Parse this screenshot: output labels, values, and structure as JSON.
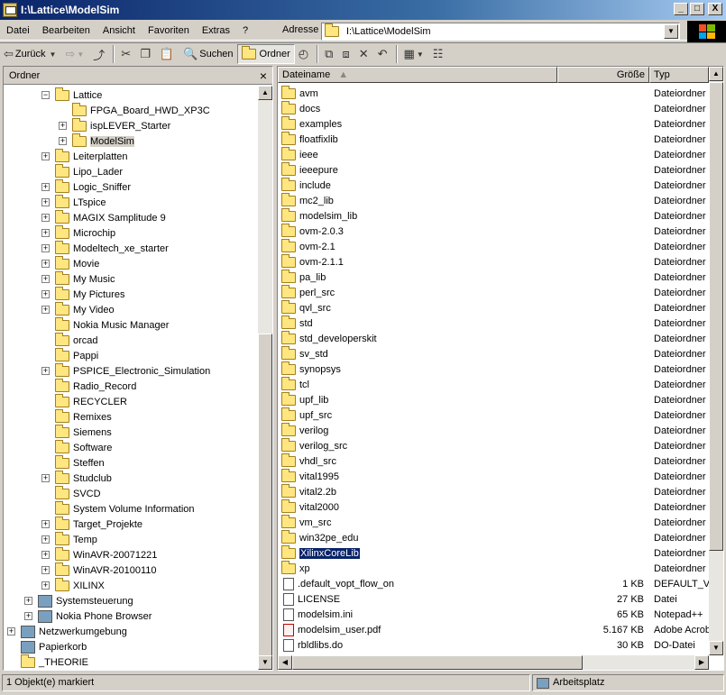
{
  "window": {
    "title": "I:\\Lattice\\ModelSim",
    "buttons": {
      "minimize": "_",
      "maximize": "□",
      "close": "X"
    }
  },
  "menu": [
    "Datei",
    "Bearbeiten",
    "Ansicht",
    "Favoriten",
    "Extras",
    "?"
  ],
  "address": {
    "label": "Adresse",
    "value": "I:\\Lattice\\ModelSim"
  },
  "toolbar": {
    "back": "Zurück",
    "search": "Suchen",
    "folders": "Ordner"
  },
  "left_pane": {
    "title": "Ordner",
    "close": "×",
    "tree": [
      {
        "label": "Lattice",
        "exp": "−",
        "indent": 2,
        "icon": "folder"
      },
      {
        "label": "FPGA_Board_HWD_XP3C",
        "exp": "",
        "indent": 3,
        "icon": "folder"
      },
      {
        "label": "ispLEVER_Starter",
        "exp": "+",
        "indent": 3,
        "icon": "folder"
      },
      {
        "label": "ModelSim",
        "exp": "+",
        "indent": 3,
        "icon": "folder-open",
        "selected": true
      },
      {
        "label": "Leiterplatten",
        "exp": "+",
        "indent": 2,
        "icon": "folder"
      },
      {
        "label": "Lipo_Lader",
        "exp": "",
        "indent": 2,
        "icon": "folder"
      },
      {
        "label": "Logic_Sniffer",
        "exp": "+",
        "indent": 2,
        "icon": "folder"
      },
      {
        "label": "LTspice",
        "exp": "+",
        "indent": 2,
        "icon": "folder"
      },
      {
        "label": "MAGIX Samplitude 9",
        "exp": "+",
        "indent": 2,
        "icon": "folder"
      },
      {
        "label": "Microchip",
        "exp": "+",
        "indent": 2,
        "icon": "folder"
      },
      {
        "label": "Modeltech_xe_starter",
        "exp": "+",
        "indent": 2,
        "icon": "folder"
      },
      {
        "label": "Movie",
        "exp": "+",
        "indent": 2,
        "icon": "folder"
      },
      {
        "label": "My Music",
        "exp": "+",
        "indent": 2,
        "icon": "folder"
      },
      {
        "label": "My Pictures",
        "exp": "+",
        "indent": 2,
        "icon": "folder"
      },
      {
        "label": "My Video",
        "exp": "+",
        "indent": 2,
        "icon": "folder"
      },
      {
        "label": "Nokia Music Manager",
        "exp": "",
        "indent": 2,
        "icon": "folder"
      },
      {
        "label": "orcad",
        "exp": "",
        "indent": 2,
        "icon": "folder"
      },
      {
        "label": "Pappi",
        "exp": "",
        "indent": 2,
        "icon": "folder"
      },
      {
        "label": "PSPICE_Electronic_Simulation",
        "exp": "+",
        "indent": 2,
        "icon": "folder"
      },
      {
        "label": "Radio_Record",
        "exp": "",
        "indent": 2,
        "icon": "folder"
      },
      {
        "label": "RECYCLER",
        "exp": "",
        "indent": 2,
        "icon": "folder"
      },
      {
        "label": "Remixes",
        "exp": "",
        "indent": 2,
        "icon": "folder"
      },
      {
        "label": "Siemens",
        "exp": "",
        "indent": 2,
        "icon": "folder"
      },
      {
        "label": "Software",
        "exp": "",
        "indent": 2,
        "icon": "folder"
      },
      {
        "label": "Steffen",
        "exp": "",
        "indent": 2,
        "icon": "folder"
      },
      {
        "label": "Studclub",
        "exp": "+",
        "indent": 2,
        "icon": "folder"
      },
      {
        "label": "SVCD",
        "exp": "",
        "indent": 2,
        "icon": "folder"
      },
      {
        "label": "System Volume Information",
        "exp": "",
        "indent": 2,
        "icon": "folder"
      },
      {
        "label": "Target_Projekte",
        "exp": "+",
        "indent": 2,
        "icon": "folder"
      },
      {
        "label": "Temp",
        "exp": "+",
        "indent": 2,
        "icon": "folder"
      },
      {
        "label": "WinAVR-20071221",
        "exp": "+",
        "indent": 2,
        "icon": "folder"
      },
      {
        "label": "WinAVR-20100110",
        "exp": "+",
        "indent": 2,
        "icon": "folder"
      },
      {
        "label": "XILINX",
        "exp": "+",
        "indent": 2,
        "icon": "folder"
      },
      {
        "label": "Systemsteuerung",
        "exp": "+",
        "indent": 1,
        "icon": "control-panel"
      },
      {
        "label": "Nokia Phone Browser",
        "exp": "+",
        "indent": 1,
        "icon": "phone"
      },
      {
        "label": "Netzwerkumgebung",
        "exp": "+",
        "indent": 0,
        "icon": "network"
      },
      {
        "label": "Papierkorb",
        "exp": "",
        "indent": 0,
        "icon": "recycle-bin"
      },
      {
        "label": "_THEORIE",
        "exp": "",
        "indent": 0,
        "icon": "folder"
      }
    ]
  },
  "right_pane": {
    "columns": {
      "name": "Dateiname",
      "size": "Größe",
      "type": "Typ"
    },
    "rows": [
      {
        "name": "avm",
        "size": "",
        "type": "Dateiordner",
        "kind": "folder"
      },
      {
        "name": "docs",
        "size": "",
        "type": "Dateiordner",
        "kind": "folder"
      },
      {
        "name": "examples",
        "size": "",
        "type": "Dateiordner",
        "kind": "folder"
      },
      {
        "name": "floatfixlib",
        "size": "",
        "type": "Dateiordner",
        "kind": "folder"
      },
      {
        "name": "ieee",
        "size": "",
        "type": "Dateiordner",
        "kind": "folder"
      },
      {
        "name": "ieeepure",
        "size": "",
        "type": "Dateiordner",
        "kind": "folder"
      },
      {
        "name": "include",
        "size": "",
        "type": "Dateiordner",
        "kind": "folder"
      },
      {
        "name": "mc2_lib",
        "size": "",
        "type": "Dateiordner",
        "kind": "folder"
      },
      {
        "name": "modelsim_lib",
        "size": "",
        "type": "Dateiordner",
        "kind": "folder"
      },
      {
        "name": "ovm-2.0.3",
        "size": "",
        "type": "Dateiordner",
        "kind": "folder"
      },
      {
        "name": "ovm-2.1",
        "size": "",
        "type": "Dateiordner",
        "kind": "folder"
      },
      {
        "name": "ovm-2.1.1",
        "size": "",
        "type": "Dateiordner",
        "kind": "folder"
      },
      {
        "name": "pa_lib",
        "size": "",
        "type": "Dateiordner",
        "kind": "folder"
      },
      {
        "name": "perl_src",
        "size": "",
        "type": "Dateiordner",
        "kind": "folder"
      },
      {
        "name": "qvl_src",
        "size": "",
        "type": "Dateiordner",
        "kind": "folder"
      },
      {
        "name": "std",
        "size": "",
        "type": "Dateiordner",
        "kind": "folder"
      },
      {
        "name": "std_developerskit",
        "size": "",
        "type": "Dateiordner",
        "kind": "folder"
      },
      {
        "name": "sv_std",
        "size": "",
        "type": "Dateiordner",
        "kind": "folder"
      },
      {
        "name": "synopsys",
        "size": "",
        "type": "Dateiordner",
        "kind": "folder"
      },
      {
        "name": "tcl",
        "size": "",
        "type": "Dateiordner",
        "kind": "folder"
      },
      {
        "name": "upf_lib",
        "size": "",
        "type": "Dateiordner",
        "kind": "folder"
      },
      {
        "name": "upf_src",
        "size": "",
        "type": "Dateiordner",
        "kind": "folder"
      },
      {
        "name": "verilog",
        "size": "",
        "type": "Dateiordner",
        "kind": "folder"
      },
      {
        "name": "verilog_src",
        "size": "",
        "type": "Dateiordner",
        "kind": "folder"
      },
      {
        "name": "vhdl_src",
        "size": "",
        "type": "Dateiordner",
        "kind": "folder"
      },
      {
        "name": "vital1995",
        "size": "",
        "type": "Dateiordner",
        "kind": "folder"
      },
      {
        "name": "vital2.2b",
        "size": "",
        "type": "Dateiordner",
        "kind": "folder"
      },
      {
        "name": "vital2000",
        "size": "",
        "type": "Dateiordner",
        "kind": "folder"
      },
      {
        "name": "vm_src",
        "size": "",
        "type": "Dateiordner",
        "kind": "folder"
      },
      {
        "name": "win32pe_edu",
        "size": "",
        "type": "Dateiordner",
        "kind": "folder"
      },
      {
        "name": "XilinxCoreLib",
        "size": "",
        "type": "Dateiordner",
        "kind": "folder",
        "selected": true
      },
      {
        "name": "xp",
        "size": "",
        "type": "Dateiordner",
        "kind": "folder"
      },
      {
        "name": ".default_vopt_flow_on",
        "size": "1 KB",
        "type": "DEFAULT_V",
        "kind": "file"
      },
      {
        "name": "LICENSE",
        "size": "27 KB",
        "type": "Datei",
        "kind": "file"
      },
      {
        "name": "modelsim.ini",
        "size": "65 KB",
        "type": "Notepad++",
        "kind": "file"
      },
      {
        "name": "modelsim_user.pdf",
        "size": "5.167 KB",
        "type": "Adobe Acrob",
        "kind": "pdf"
      },
      {
        "name": "rbldlibs.do",
        "size": "30 KB",
        "type": "DO-Datei",
        "kind": "file"
      }
    ]
  },
  "status": {
    "selection": "1 Objekt(e) markiert",
    "location": "Arbeitsplatz"
  },
  "colors": {
    "title_active": "#0a246a",
    "selection": "#0a246a",
    "face": "#d4d0c8"
  }
}
